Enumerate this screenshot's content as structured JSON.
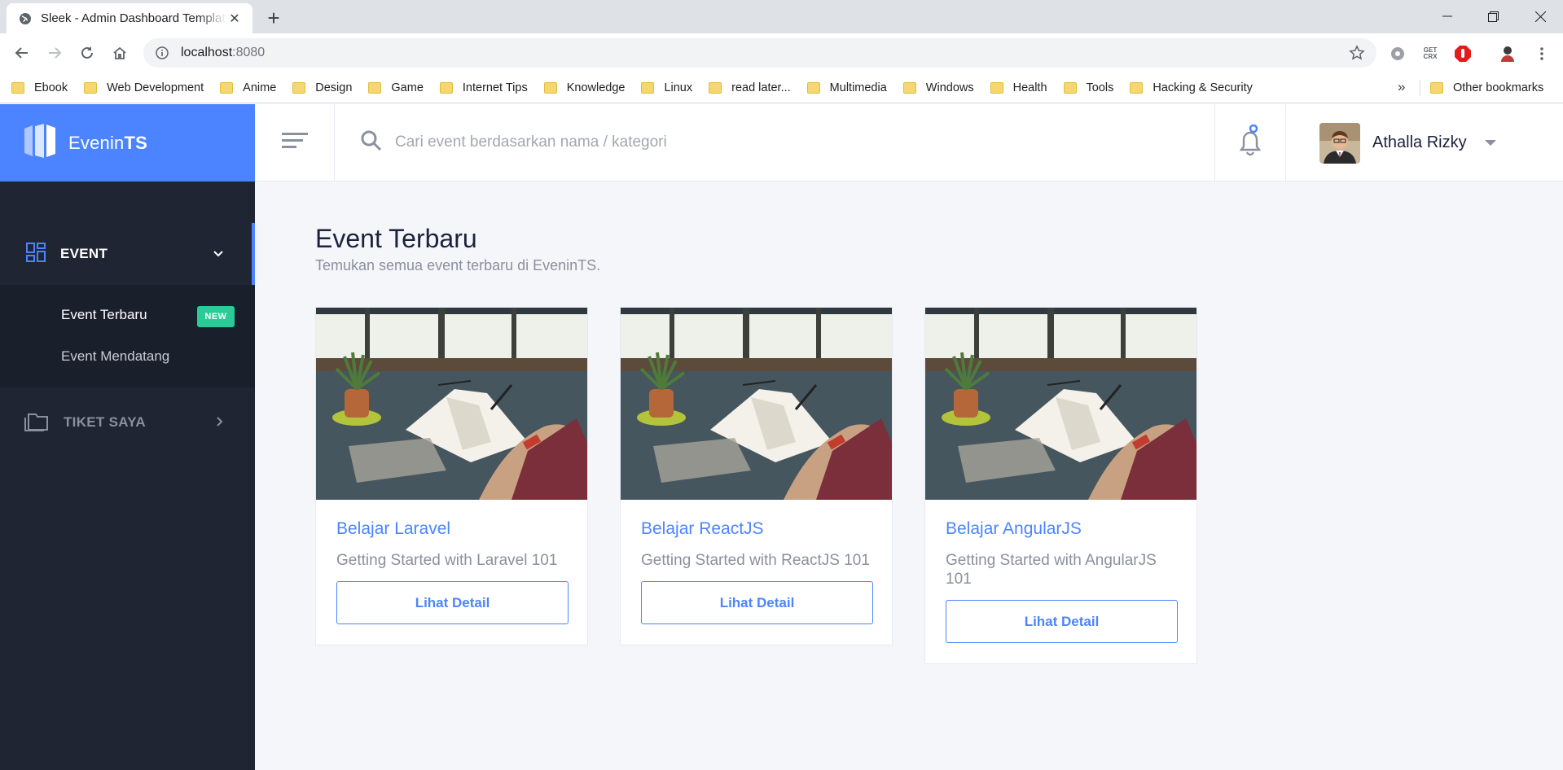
{
  "browser": {
    "tab_title": "Sleek - Admin Dashboard Template",
    "url_host": "localhost",
    "url_port": ":8080",
    "bookmarks": [
      "Ebook",
      "Web Development",
      "Anime",
      "Design",
      "Game",
      "Internet Tips",
      "Knowledge",
      "Linux",
      "read later...",
      "Multimedia",
      "Windows",
      "Health",
      "Tools",
      "Hacking & Security"
    ],
    "more": "»",
    "other_bookmarks": "Other bookmarks",
    "ext_getcrx": "GET CRX"
  },
  "app": {
    "brand_light": "Evenin",
    "brand_bold": "TS",
    "brand_color": "#4c84ff",
    "sidebar_color": "#1f2533",
    "menu": {
      "event": "EVENT",
      "event_items": [
        {
          "label": "Event Terbaru",
          "badge": "NEW"
        },
        {
          "label": "Event Mendatang"
        }
      ],
      "tiket": "TIKET SAYA"
    },
    "search_placeholder": "Cari event berdasarkan nama / kategori",
    "user_name": "Athalla Rizky",
    "page_title": "Event Terbaru",
    "page_subtitle": "Temukan semua event terbaru di EveninTS.",
    "cards": [
      {
        "title": "Belajar Laravel",
        "text": "Getting Started with Laravel 101",
        "button": "Lihat Detail"
      },
      {
        "title": "Belajar ReactJS",
        "text": "Getting Started with ReactJS 101",
        "button": "Lihat Detail"
      },
      {
        "title": "Belajar AngularJS",
        "text": "Getting Started with AngularJS 101",
        "button": "Lihat Detail"
      }
    ]
  }
}
